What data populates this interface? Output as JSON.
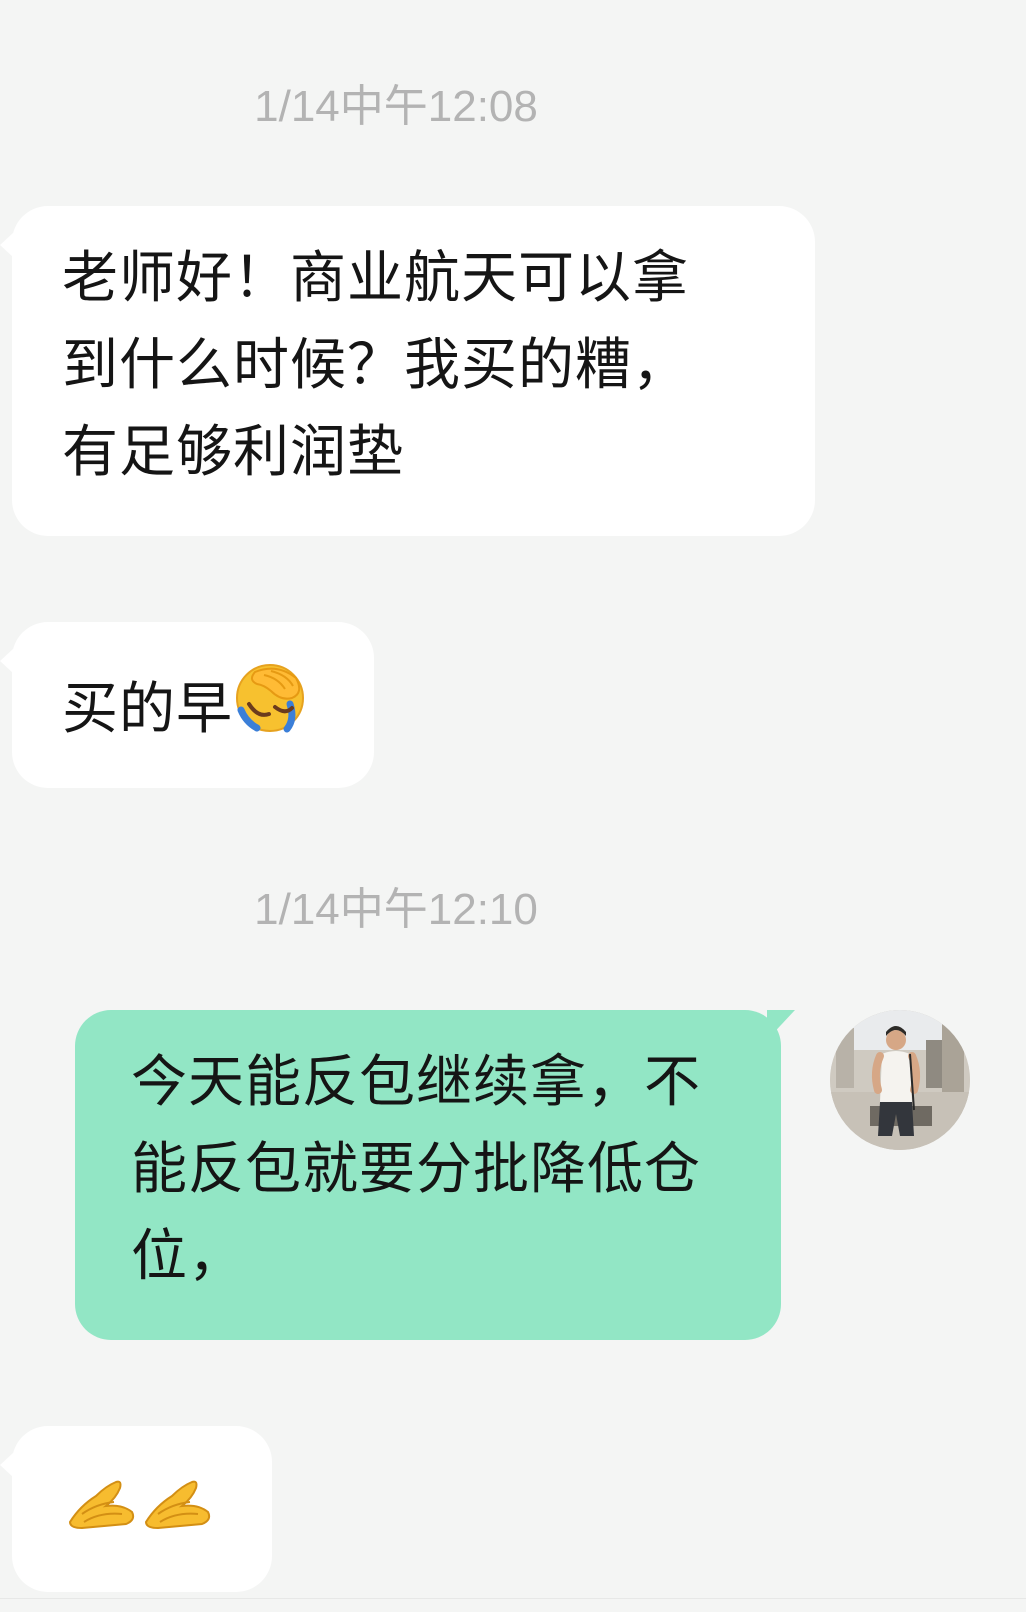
{
  "messages": {
    "ts1": "1/14中午12:08",
    "msg1": "老师好！商业航天可以拿到什么时候？我买的糟，有足够利润垫",
    "msg2_text": "买的早",
    "msg2_emoji": "face-palm-crying-emoji",
    "ts2": "1/14中午12:10",
    "msg3": "今天能反包继续拿，不能反包就要分批降低仓位，",
    "msg4_emoji": "folded-hands-emoji x2"
  },
  "colors": {
    "background": "#f4f5f4",
    "incoming_bubble": "#ffffff",
    "outgoing_bubble": "#92e6c5",
    "timestamp_text": "#b3b3b3",
    "message_text": "#151515"
  },
  "icons": {
    "avatar": "user-avatar-photo"
  }
}
